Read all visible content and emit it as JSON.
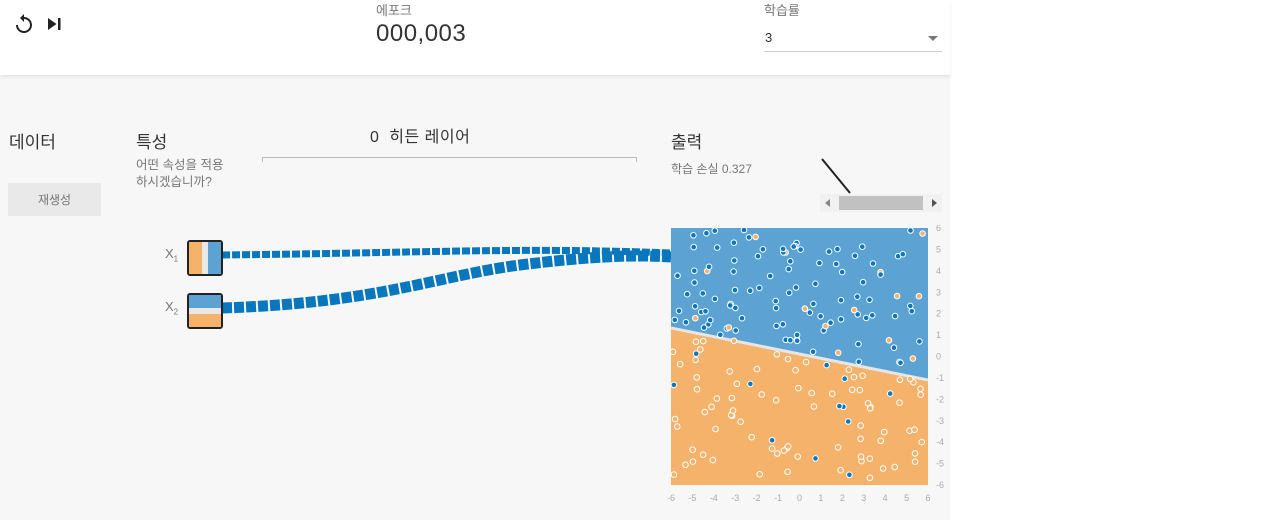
{
  "controls": {
    "reset_icon": "reset-icon",
    "step_icon": "step-forward-icon",
    "epoch_label": "에포크",
    "epoch_value": "000,003",
    "learning_rate_label": "학습률",
    "learning_rate_value": "3"
  },
  "columns": {
    "data_title": "데이터",
    "regenerate_label": "재생성",
    "features_title": "특성",
    "features_desc": "어떤 속성을 적용하시겠습니까?",
    "hidden_count": "0",
    "hidden_title": "히든 레이어",
    "output_title": "출력",
    "loss_label": "학습 손실",
    "loss_value": "0.327"
  },
  "features": [
    {
      "label": "X",
      "sub": "1"
    },
    {
      "label": "X",
      "sub": "2"
    }
  ],
  "output_axes": {
    "ticks": [
      "-6",
      "-5",
      "-4",
      "-3",
      "-2",
      "-1",
      "0",
      "1",
      "2",
      "3",
      "4",
      "5",
      "6"
    ]
  },
  "colors": {
    "positive": "#5ca3d4",
    "negative": "#f5b26b",
    "link": "#0877bd"
  }
}
